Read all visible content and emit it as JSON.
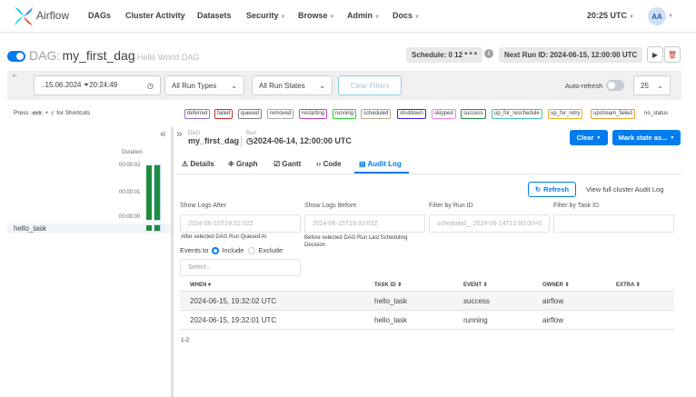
{
  "nav": {
    "brand": "Airflow",
    "items": [
      "DAGs",
      "Cluster Activity",
      "Datasets",
      "Security",
      "Browse",
      "Admin",
      "Docs"
    ],
    "time": "20:25 UTC",
    "avatar": "AA"
  },
  "dag_header": {
    "prefix": "DAG:",
    "dag_id": "my_first_dag",
    "description": "Hello World DAG",
    "schedule": "Schedule: 0 12 * * *",
    "next_run": "Next Run ID: 2024-06-15, 12:00:00 UTC"
  },
  "filters": {
    "datetime": "..15.06.2024 ⏷20:24:49",
    "run_types": "All Run Types",
    "run_states": "All Run States",
    "clear_filters": "Clear Filters",
    "auto_refresh": "Auto-refresh",
    "page_size": "25"
  },
  "shortcuts": {
    "press": "Press",
    "key1": "shift",
    "plus": "+",
    "key2": "/",
    "for": "for Shortcuts"
  },
  "legend": [
    {
      "label": "deferred",
      "color": "#9370db"
    },
    {
      "label": "failed",
      "color": "#d0302f"
    },
    {
      "label": "queued",
      "color": "#808080"
    },
    {
      "label": "removed",
      "color": "#a9a9a9"
    },
    {
      "label": "restarting",
      "color": "#c040c0"
    },
    {
      "label": "running",
      "color": "#32cd32"
    },
    {
      "label": "scheduled",
      "color": "#b5a88a"
    },
    {
      "label": "shutdown",
      "color": "#3020d0"
    },
    {
      "label": "skipped",
      "color": "#f080f0"
    },
    {
      "label": "success",
      "color": "#1e8e3e"
    },
    {
      "label": "up_for_reschedule",
      "color": "#40c0c0"
    },
    {
      "label": "up_for_retry",
      "color": "#e8b020"
    },
    {
      "label": "upstream_failed",
      "color": "#f0a020"
    },
    {
      "label": "no_status",
      "color": "#ffffff"
    }
  ],
  "grid": {
    "duration_label": "Duration",
    "ticks": [
      "00:00:02",
      "00:00:01",
      "00:00:00"
    ],
    "task": "hello_task"
  },
  "run_header": {
    "dag_small": "DAG",
    "dag_id": "my_first_dag",
    "run_small": "Run",
    "run_id": "2024-06-14, 12:00:00 UTC",
    "clear": "Clear",
    "mark_state": "Mark state as..."
  },
  "tabs": [
    {
      "icon": "⚠",
      "label": "Details"
    },
    {
      "icon": "⁜",
      "label": "Graph"
    },
    {
      "icon": "☑",
      "label": "Gantt"
    },
    {
      "icon": "‹›",
      "label": "Code"
    },
    {
      "icon": "▤",
      "label": "Audit Log"
    }
  ],
  "audit": {
    "refresh": "Refresh",
    "full_log": "View full cluster Audit Log",
    "show_after_label": "Show Logs After",
    "show_before_label": "Show Logs Before",
    "filter_run_label": "Filter by Run ID",
    "filter_task_label": "Filter by Task ID",
    "show_after_value": "2024-06-15T19:32:02Z",
    "show_before_value": "2024-06-15T19:32:03Z",
    "run_id_value": "scheduled__2024-06-14T12:00:00+0",
    "after_hint": "After selected DAG Run Queued At",
    "before_hint": "Before selected DAG Run Last Scheduling Decision",
    "events_to": "Events to",
    "include": "Include",
    "exclude": "Exclude",
    "select_placeholder": "Select...",
    "columns": [
      "WHEN",
      "TASK ID",
      "EVENT",
      "OWNER",
      "EXTRA"
    ],
    "rows": [
      {
        "when": "2024-06-15, 19:32:02 UTC",
        "task_id": "hello_task",
        "event": "success",
        "owner": "airflow"
      },
      {
        "when": "2024-06-15, 19:32:01 UTC",
        "task_id": "hello_task",
        "event": "running",
        "owner": "airflow"
      }
    ],
    "pagination": "1-2"
  }
}
